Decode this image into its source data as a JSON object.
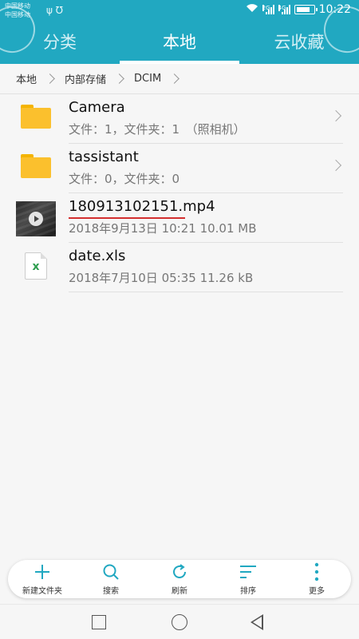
{
  "status_bar": {
    "carrier_1": "中国移动",
    "carrier_2": "中国移动",
    "network_1": "2G",
    "network_2": "4G",
    "time": "10:22"
  },
  "tabs": [
    {
      "label": "分类",
      "active": false
    },
    {
      "label": "本地",
      "active": true
    },
    {
      "label": "云收藏",
      "active": false
    }
  ],
  "breadcrumb": [
    "本地",
    "内部存储",
    "DCIM"
  ],
  "files": [
    {
      "name": "Camera",
      "meta": "文件：1，文件夹：1　（照相机）",
      "type": "folder",
      "icon": "folder-icon"
    },
    {
      "name": "tassistant",
      "meta": "文件：0，文件夹：0",
      "type": "folder",
      "icon": "folder-icon"
    },
    {
      "name": "180913102151.mp4",
      "meta": "2018年9月13日 10:21 10.01 MB",
      "type": "video",
      "icon": "video-thumbnail"
    },
    {
      "name": "date.xls",
      "meta": "2018年7月10日 05:35 11.26 kB",
      "type": "spreadsheet",
      "icon": "excel-icon"
    }
  ],
  "toolbar": [
    {
      "label": "新建文件夹",
      "icon": "plus-icon"
    },
    {
      "label": "搜索",
      "icon": "search-icon"
    },
    {
      "label": "刷新",
      "icon": "refresh-icon"
    },
    {
      "label": "排序",
      "icon": "sort-icon"
    },
    {
      "label": "更多",
      "icon": "more-icon"
    }
  ],
  "colors": {
    "header": "#21a8c1",
    "accent": "#21a8c1",
    "folder": "#fbc02d",
    "underline": "#d32f2f"
  }
}
